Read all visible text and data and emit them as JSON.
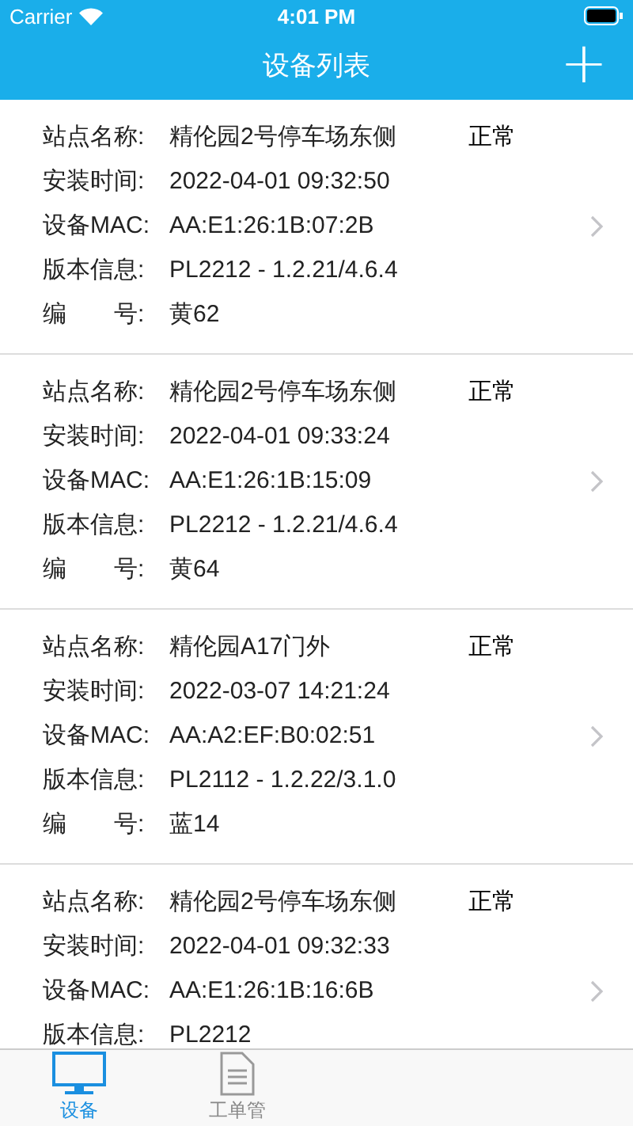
{
  "status_bar": {
    "carrier": "Carrier",
    "time": "4:01 PM"
  },
  "nav_bar": {
    "title": "设备列表",
    "add_button": "+"
  },
  "devices": [
    {
      "status": "正常",
      "fields": [
        {
          "label": "站点名称:",
          "value": "精伦园2号停车场东侧"
        },
        {
          "label": "安装时间:",
          "value": "2022-04-01 09:32:50"
        },
        {
          "label": "设备MAC:",
          "value": "AA:E1:26:1B:07:2B"
        },
        {
          "label": "版本信息:",
          "value": "PL2212 - 1.2.21/4.6.4"
        },
        {
          "label": "编　　号:",
          "value": "黄62"
        }
      ]
    },
    {
      "status": "正常",
      "fields": [
        {
          "label": "站点名称:",
          "value": "精伦园2号停车场东侧"
        },
        {
          "label": "安装时间:",
          "value": "2022-04-01 09:33:24"
        },
        {
          "label": "设备MAC:",
          "value": "AA:E1:26:1B:15:09"
        },
        {
          "label": "版本信息:",
          "value": "PL2212 - 1.2.21/4.6.4"
        },
        {
          "label": "编　　号:",
          "value": "黄64"
        }
      ]
    },
    {
      "status": "正常",
      "fields": [
        {
          "label": "站点名称:",
          "value": "精伦园A17门外"
        },
        {
          "label": "安装时间:",
          "value": "2022-03-07 14:21:24"
        },
        {
          "label": "设备MAC:",
          "value": "AA:A2:EF:B0:02:51"
        },
        {
          "label": "版本信息:",
          "value": "PL2112 - 1.2.22/3.1.0"
        },
        {
          "label": "编　　号:",
          "value": "蓝14"
        }
      ]
    },
    {
      "status": "正常",
      "fields": [
        {
          "label": "站点名称:",
          "value": "精伦园2号停车场东侧"
        },
        {
          "label": "安装时间:",
          "value": "2022-04-01 09:32:33"
        },
        {
          "label": "设备MAC:",
          "value": "AA:E1:26:1B:16:6B"
        },
        {
          "label": "版本信息:",
          "value": "PL2212"
        }
      ]
    }
  ],
  "tab_bar": [
    {
      "kind": "monitor",
      "label": "设备",
      "selected": true
    },
    {
      "kind": "document",
      "label": "工单管",
      "selected": false
    }
  ]
}
